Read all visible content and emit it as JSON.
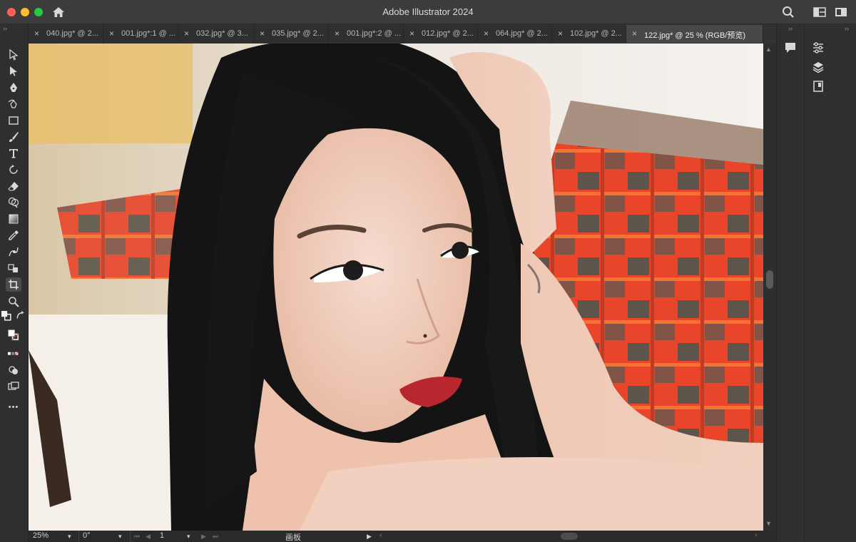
{
  "window": {
    "title": "Adobe Illustrator 2024"
  },
  "tabs": [
    {
      "label": "040.jpg* @ 2...",
      "active": false
    },
    {
      "label": "001.jpg*:1 @ ...",
      "active": false
    },
    {
      "label": "032.jpg* @ 3...",
      "active": false
    },
    {
      "label": "035.jpg* @ 2...",
      "active": false
    },
    {
      "label": "001.jpg*:2 @ ...",
      "active": false
    },
    {
      "label": "012.jpg* @ 2...",
      "active": false
    },
    {
      "label": "064.jpg* @ 2...",
      "active": false
    },
    {
      "label": "102.jpg* @ 2...",
      "active": false
    },
    {
      "label": "122.jpg* @ 25 % (RGB/预览)",
      "active": true
    }
  ],
  "tab_close_glyph": "×",
  "panel_collapse_glyph": "››",
  "toolbar": {
    "tools": [
      "selection-tool",
      "direct-selection-tool",
      "pen-tool",
      "curvature-tool",
      "rectangle-tool",
      "paintbrush-tool",
      "type-tool",
      "rotate-tool",
      "eraser-tool",
      "shape-builder-tool",
      "gradient-tool",
      "eyedropper-tool",
      "puppet-warp-tool",
      "perspective-tool",
      "artboard-tool",
      "zoom-tool"
    ],
    "selected_tool": "artboard-tool",
    "more_label": "•••"
  },
  "statusbar": {
    "zoom": "25%",
    "rotation": "0°",
    "artboard_number": "1",
    "artboard_label": "画板"
  },
  "colors": {
    "accent_fill": "#ffffff",
    "stroke_none": "#e03030",
    "chrome_bg": "#323232"
  }
}
